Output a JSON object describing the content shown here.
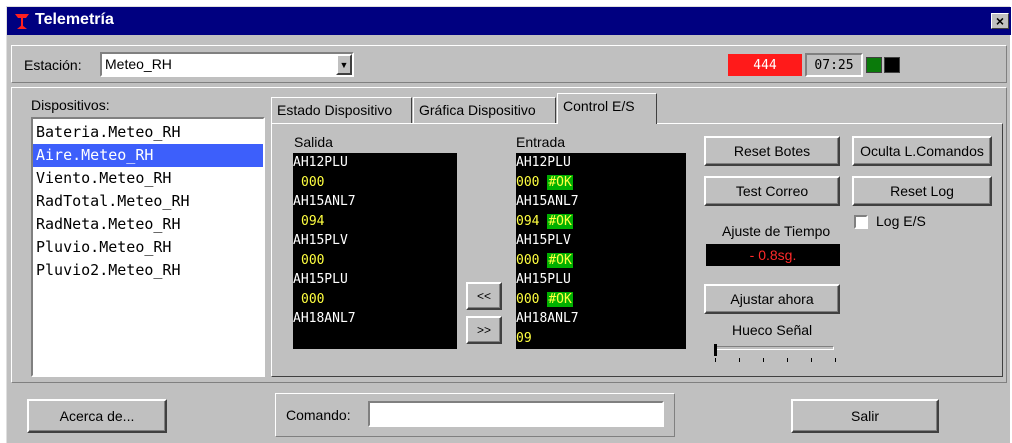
{
  "window": {
    "title": "Telemetría",
    "close_glyph": "×"
  },
  "station": {
    "label": "Estación:",
    "value": "Meteo_RH"
  },
  "status": {
    "red_value": "444",
    "time": "07:25",
    "led_colors": [
      "#0a7a0a",
      "#000000"
    ],
    "red_color": "#ff1a1a"
  },
  "devices": {
    "label": "Dispositivos:",
    "items": [
      "Bateria.Meteo_RH",
      "Aire.Meteo_RH",
      "Viento.Meteo_RH",
      "RadTotal.Meteo_RH",
      "RadNeta.Meteo_RH",
      "Pluvio.Meteo_RH",
      "Pluvio2.Meteo_RH"
    ],
    "selected_index": 1
  },
  "tabs": [
    {
      "label": "Estado Dispositivo"
    },
    {
      "label": "Gráfica Dispositivo"
    },
    {
      "label": "Control E/S",
      "active": true
    }
  ],
  "control": {
    "salida_label": "Salida",
    "entrada_label": "Entrada",
    "salida": [
      {
        "name": "AH12PLU",
        "value": "000"
      },
      {
        "name": "AH15ANL7",
        "value": "094"
      },
      {
        "name": "AH15PLV",
        "value": "000"
      },
      {
        "name": "AH15PLU",
        "value": "000"
      },
      {
        "name": "AH18ANL7",
        "value": ""
      }
    ],
    "entrada": [
      {
        "name": "AH12PLU",
        "value": "000",
        "flag": "#OK"
      },
      {
        "name": "AH15ANL7",
        "value": "094",
        "flag": "#OK"
      },
      {
        "name": "AH15PLV",
        "value": "000",
        "flag": "#OK"
      },
      {
        "name": "AH15PLU",
        "value": "000",
        "flag": "#OK"
      },
      {
        "name": "AH18ANL7",
        "value": "09",
        "flag": ""
      }
    ],
    "move_left": "<<",
    "move_right": ">>",
    "reset_botes": "Reset Botes",
    "oculta_comandos": "Oculta L.Comandos",
    "test_correo": "Test Correo",
    "reset_log": "Reset Log",
    "log_es_label": "Log E/S",
    "log_es_checked": false,
    "ajuste_label": "Ajuste de Tiempo",
    "ajuste_value": "- 0.8sg.",
    "ajustar_ahora": "Ajustar ahora",
    "hueco_label": "Hueco Señal",
    "hueco_level": 0
  },
  "footer": {
    "about": "Acerca de...",
    "command_label": "Comando:",
    "command_value": "",
    "exit": "Salir"
  }
}
